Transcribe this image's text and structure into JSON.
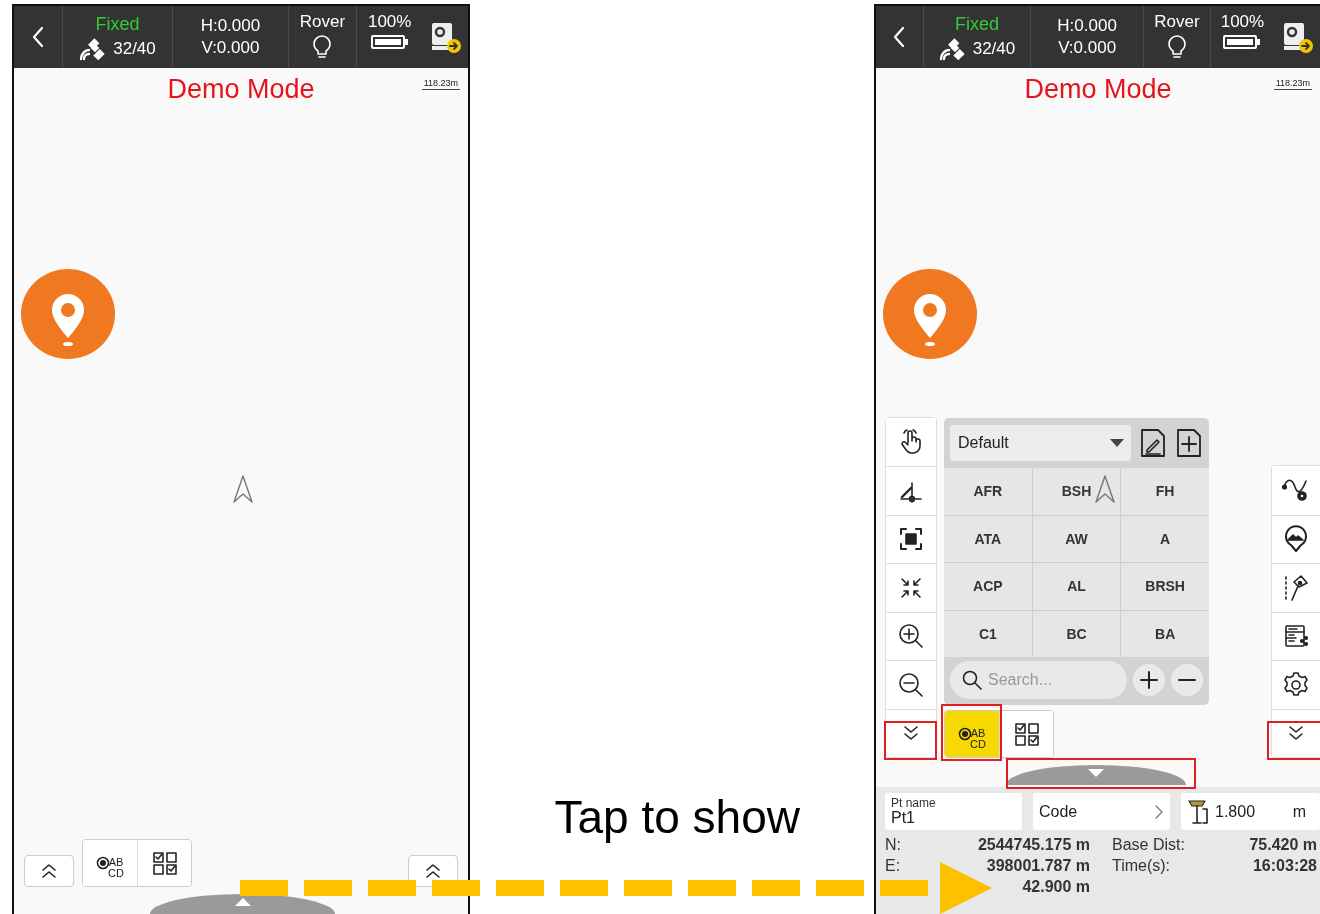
{
  "left_screen": {
    "status_bar": {
      "fix_status": "Fixed",
      "satellites": "32/40",
      "h_precision": "H:0.000",
      "v_precision": "V:0.000",
      "mode": "Rover",
      "battery": "100%"
    },
    "banner": "Demo Mode",
    "scale": "118.23m",
    "toggles": [
      {
        "kind": "code",
        "label_lines": [
          "AB",
          "CD"
        ],
        "selected": false
      },
      {
        "kind": "checklist",
        "selected": false
      }
    ]
  },
  "caption": "Tap to show",
  "right_screen": {
    "status_bar": {
      "fix_status": "Fixed",
      "satellites": "32/40",
      "h_precision": "H:0.000",
      "v_precision": "V:0.000",
      "mode": "Rover",
      "battery": "100%"
    },
    "banner": "Demo Mode",
    "scale": "118.23m",
    "code_panel": {
      "library": "Default",
      "codes": [
        "AFR",
        "BSH",
        "FH",
        "ATA",
        "AW",
        "A",
        "ACP",
        "AL",
        "BRSH",
        "C1",
        "BC",
        "BA"
      ],
      "search_placeholder": "Search..."
    },
    "toggles": [
      {
        "kind": "code",
        "label_lines": [
          "AB",
          "CD"
        ],
        "selected": true
      },
      {
        "kind": "checklist",
        "selected": false
      }
    ],
    "point_name": {
      "label": "Pt name",
      "value": "Pt1"
    },
    "code_field": "Code",
    "antenna_height": {
      "value": "1.800",
      "unit": "m"
    },
    "readings": [
      {
        "label": "N:",
        "value": "2544745.175 m"
      },
      {
        "label": "E:",
        "value": "398001.787 m"
      },
      {
        "value": "42.900 m"
      }
    ],
    "info": [
      {
        "label": "Base Dist:",
        "value": "75.420 m"
      },
      {
        "label": "Time(s):",
        "value": "16:03:28"
      }
    ]
  }
}
